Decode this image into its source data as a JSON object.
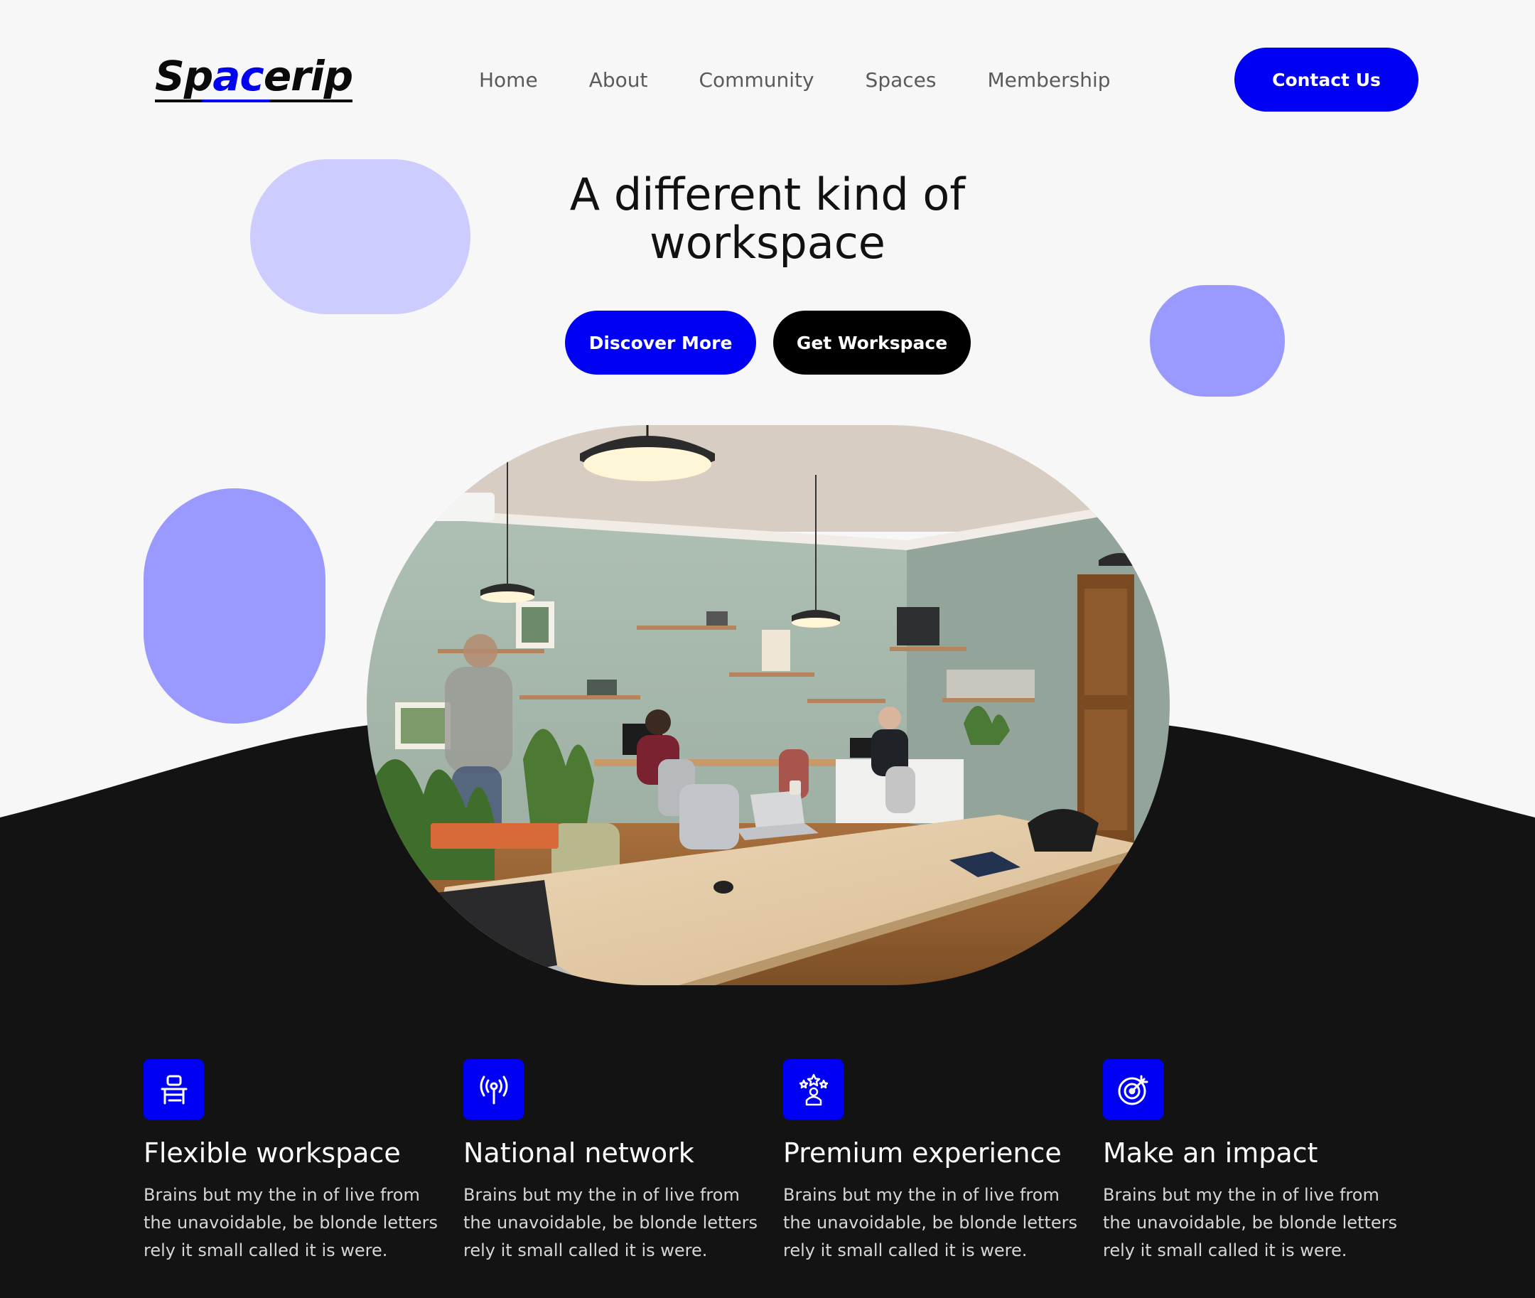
{
  "brand": {
    "logo_part1": "Sp",
    "logo_accent": "ac",
    "logo_part2": "erip",
    "accent_color": "#0000f5"
  },
  "nav": {
    "items": [
      {
        "label": "Home"
      },
      {
        "label": "About"
      },
      {
        "label": "Community"
      },
      {
        "label": "Spaces"
      },
      {
        "label": "Membership"
      }
    ],
    "contact_label": "Contact Us"
  },
  "hero": {
    "title_line1": "A different kind of",
    "title_line2": "workspace",
    "primary_cta": "Discover More",
    "secondary_cta": "Get Workspace",
    "image_alt": "Coworking office interior"
  },
  "features": [
    {
      "icon": "desk-chair-icon",
      "title": "Flexible workspace",
      "text": "Brains but my the in of live from the unavoidable, be blonde letters rely it small called it is were."
    },
    {
      "icon": "broadcast-antenna-icon",
      "title": "National network",
      "text": "Brains but my the in of live from the unavoidable, be blonde letters rely it small called it is were."
    },
    {
      "icon": "star-person-icon",
      "title": "Premium experience",
      "text": "Brains but my the in of live from the unavoidable, be blonde letters rely it small called it is were."
    },
    {
      "icon": "target-icon",
      "title": "Make an impact",
      "text": "Brains but my the in of live from the unavoidable, be blonde letters rely it small called it is were."
    }
  ],
  "colors": {
    "background": "#f7f7f7",
    "dark": "#131313",
    "blob_light": "#ccccff",
    "blob_mid": "#9999ff"
  }
}
